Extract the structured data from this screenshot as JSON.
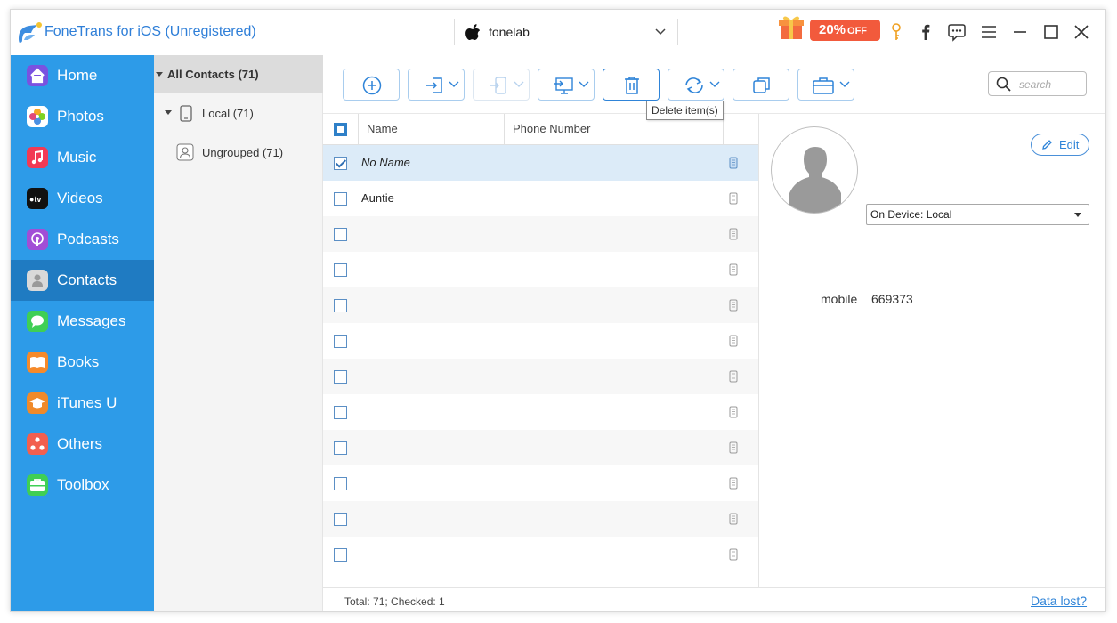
{
  "app": {
    "title": "FoneTrans for iOS (Unregistered)",
    "device_name": "fonelab",
    "promo_text": "20%",
    "promo_suffix": "OFF"
  },
  "sidebar": {
    "items": [
      {
        "label": "Home",
        "icon": "home-icon",
        "color": "#7a52e0"
      },
      {
        "label": "Photos",
        "icon": "photos-icon",
        "color": "#ffffff"
      },
      {
        "label": "Music",
        "icon": "music-icon",
        "color": "#f23a54"
      },
      {
        "label": "Videos",
        "icon": "apple-tv-icon",
        "color": "#111111"
      },
      {
        "label": "Podcasts",
        "icon": "podcasts-icon",
        "color": "#a24ed6"
      },
      {
        "label": "Contacts",
        "icon": "contacts-icon",
        "color": "#d9d9d9",
        "active": true
      },
      {
        "label": "Messages",
        "icon": "messages-icon",
        "color": "#3fcf55"
      },
      {
        "label": "Books",
        "icon": "books-icon",
        "color": "#f68a2a"
      },
      {
        "label": "iTunes U",
        "icon": "itunes-u-icon",
        "color": "#f08a2a"
      },
      {
        "label": "Others",
        "icon": "others-icon",
        "color": "#f25f4f"
      },
      {
        "label": "Toolbox",
        "icon": "toolbox-icon",
        "color": "#3fcf55"
      }
    ]
  },
  "groups": {
    "all": "All Contacts  (71)",
    "local": "Local  (71)",
    "ungrouped": "Ungrouped  (71)"
  },
  "toolbar": {
    "tooltip": "Delete item(s)",
    "search_placeholder": "search"
  },
  "table": {
    "columns": {
      "name": "Name",
      "phone": "Phone Number"
    },
    "rows": [
      {
        "name": "No Name",
        "checked": true,
        "selected": true
      },
      {
        "name": "Auntie",
        "checked": false
      },
      {
        "name": "",
        "checked": false
      },
      {
        "name": "",
        "checked": false
      },
      {
        "name": "",
        "checked": false
      },
      {
        "name": "",
        "checked": false
      },
      {
        "name": "",
        "checked": false
      },
      {
        "name": "",
        "checked": false
      },
      {
        "name": "",
        "checked": false
      },
      {
        "name": "",
        "checked": false
      },
      {
        "name": "",
        "checked": false
      },
      {
        "name": "",
        "checked": false
      }
    ]
  },
  "footer": {
    "status": "Total: 71; Checked: 1",
    "data_lost": "Data lost?"
  },
  "details": {
    "edit_label": "Edit",
    "location": "On Device: Local",
    "field_label": "mobile",
    "field_value": "669373"
  },
  "colors": {
    "sidebar": "#2d9be8",
    "sidebar_active": "#1f7bc2",
    "accent": "#2f84d8",
    "promo": "#f25a3c"
  }
}
